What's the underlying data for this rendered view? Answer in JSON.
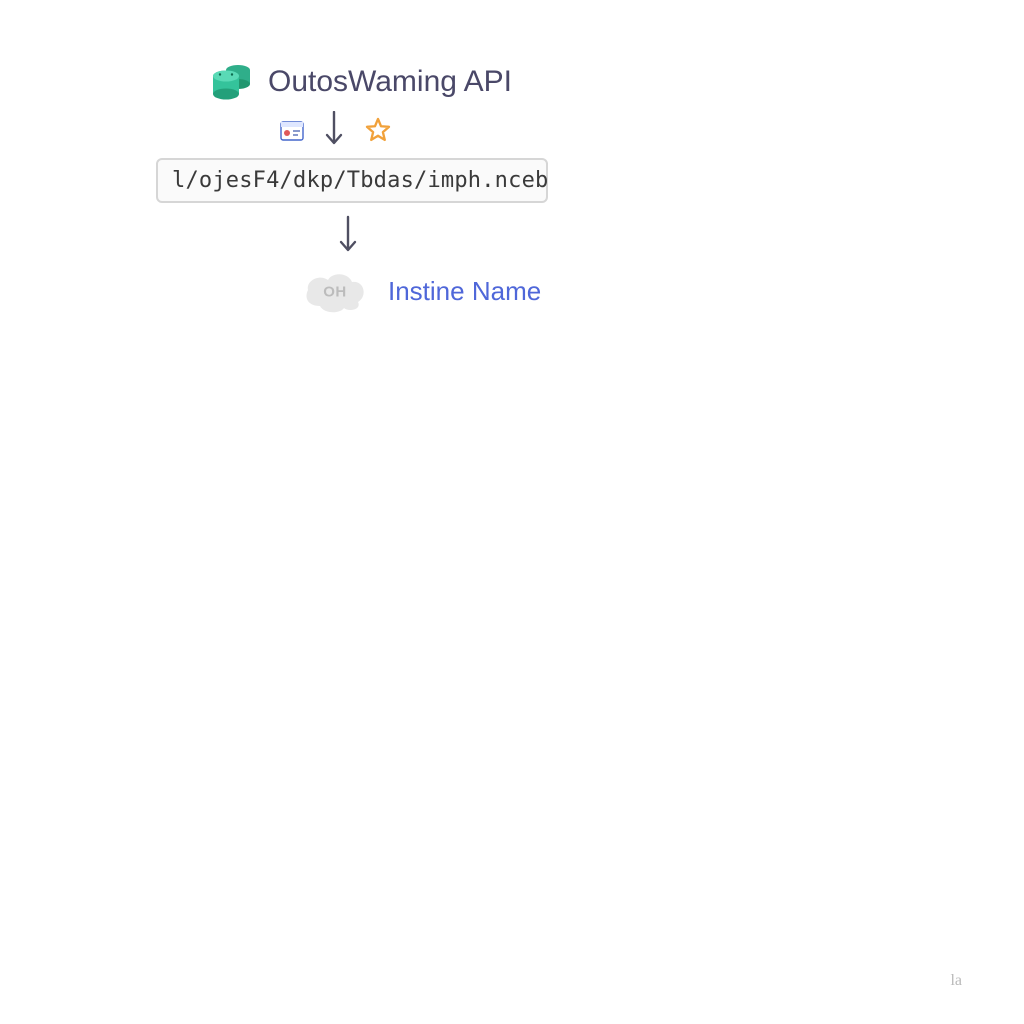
{
  "api": {
    "title": "OutosWaming API",
    "db_icon": "database-icon"
  },
  "icons": {
    "calendar": "calendar-icon",
    "arrow1": "arrow-down-icon",
    "star": "star-icon",
    "arrow2": "arrow-down-icon"
  },
  "path": {
    "value": "l/ojesF4/dkp/Tbdas/imph.nceb"
  },
  "instance": {
    "cloud_tag": "OH",
    "label": "Instine Name"
  },
  "watermark": "la",
  "colors": {
    "db_green": "#2fae8a",
    "title": "#4a4868",
    "path_border": "#d6d6d6",
    "path_bg": "#fafafa",
    "arrow": "#5a5a6a",
    "star": "#f1a13a",
    "cloud_fill": "#e6e6e6",
    "cloud_text": "#bcbcbc",
    "instance": "#4f67d9"
  }
}
